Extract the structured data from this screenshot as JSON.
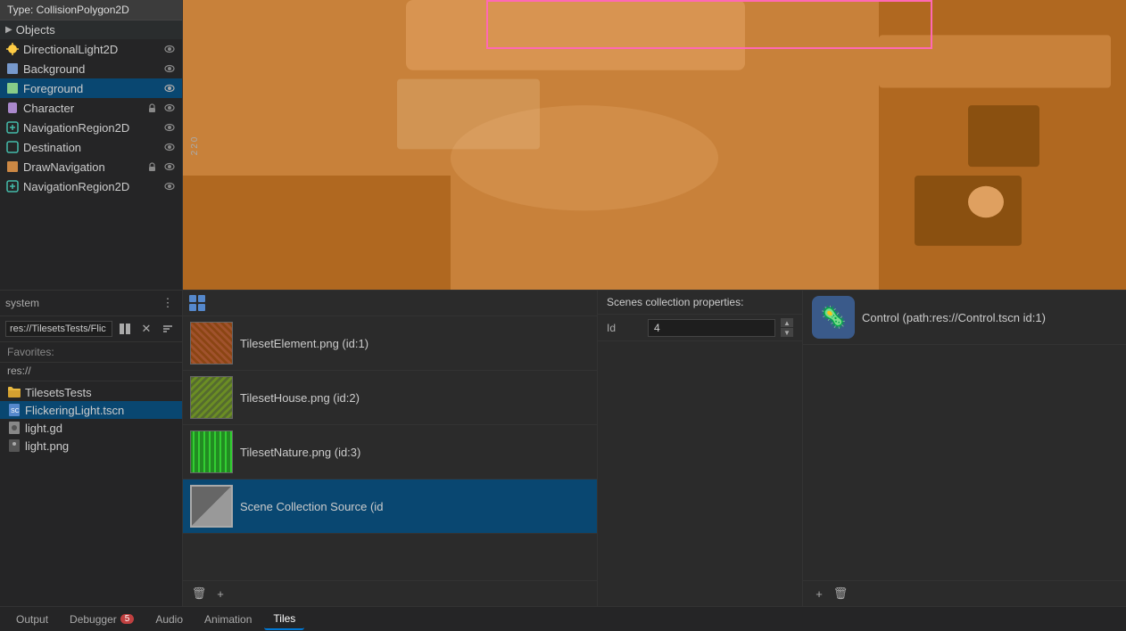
{
  "tooltip": {
    "text": "Type: CollisionPolygon2D"
  },
  "sidebar": {
    "objects_label": "Objects",
    "items": [
      {
        "id": "directional",
        "label": "DirectionalLight2D",
        "has_vis": true,
        "has_lock": false,
        "selected": false
      },
      {
        "id": "background",
        "label": "Background",
        "has_vis": true,
        "has_lock": false,
        "selected": false
      },
      {
        "id": "foreground",
        "label": "Foreground",
        "has_vis": true,
        "has_lock": false,
        "selected": true
      },
      {
        "id": "character",
        "label": "Character",
        "has_vis": true,
        "has_lock": true,
        "selected": false
      },
      {
        "id": "navregion1",
        "label": "NavigationRegion2D",
        "has_vis": true,
        "has_lock": false,
        "selected": false
      },
      {
        "id": "destination",
        "label": "Destination",
        "has_vis": true,
        "has_lock": false,
        "selected": false
      },
      {
        "id": "drawnavigation",
        "label": "DrawNavigation",
        "has_vis": false,
        "has_lock": true,
        "selected": false
      },
      {
        "id": "navregion2",
        "label": "NavigationRegion2D",
        "has_vis": true,
        "has_lock": false,
        "selected": false
      }
    ]
  },
  "filesystem": {
    "path_label": "res://TilesetsTests/Flic",
    "favorites_label": "Favorites:",
    "res_label": "res://",
    "items": [
      {
        "id": "tilesets",
        "label": "TilesetsTests",
        "is_folder": true,
        "selected": false
      },
      {
        "id": "flickering",
        "label": "FlickeringLight.tscn",
        "is_folder": false,
        "selected": true
      },
      {
        "id": "lightgd",
        "label": "light.gd",
        "is_folder": false,
        "selected": false
      },
      {
        "id": "lightpng",
        "label": "light.png",
        "is_folder": false,
        "selected": false
      }
    ]
  },
  "tileset_panel": {
    "items": [
      {
        "id": "element",
        "label": "TilesetElement.png (id:1)",
        "thumb_class": "thumb-element"
      },
      {
        "id": "house",
        "label": "TilesetHouse.png (id:2)",
        "thumb_class": "thumb-house"
      },
      {
        "id": "nature",
        "label": "TilesetNature.png (id:3)",
        "thumb_class": "thumb-nature"
      },
      {
        "id": "scene_source",
        "label": "Scene Collection Source (id",
        "thumb_class": "thumb-scene",
        "selected": true
      }
    ],
    "add_btn": "+",
    "delete_btn": "🗑"
  },
  "properties": {
    "title": "Scenes collection properties:",
    "id_label": "Id",
    "id_value": "4",
    "spinner_up": "▲",
    "spinner_down": "▼"
  },
  "source": {
    "icon_emoji": "🦠",
    "source_name": "Control (path:res://Control.tscn id:1)",
    "add_btn": "+",
    "delete_btn": "🗑"
  },
  "bottom_tabs": [
    {
      "id": "output",
      "label": "Output",
      "active": false,
      "badge": null
    },
    {
      "id": "debugger",
      "label": "Debugger",
      "active": false,
      "badge": "5"
    },
    {
      "id": "audio",
      "label": "Audio",
      "active": false,
      "badge": null
    },
    {
      "id": "animation",
      "label": "Animation",
      "active": false,
      "badge": null
    },
    {
      "id": "tiles",
      "label": "Tiles",
      "active": true,
      "badge": null
    }
  ],
  "viewport": {
    "number": "220"
  }
}
